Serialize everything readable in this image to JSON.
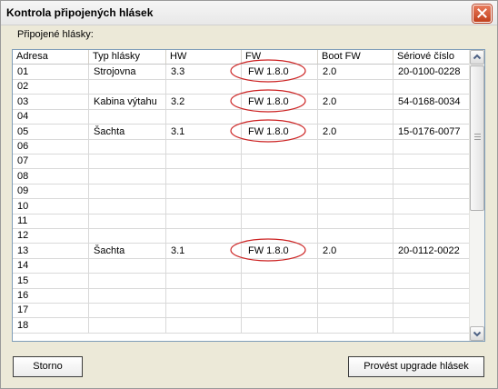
{
  "window": {
    "title": "Kontrola připojených hlásek"
  },
  "group_label": "Připojené hlásky:",
  "table": {
    "columns": [
      "Adresa",
      "Typ hlásky",
      "HW",
      "FW",
      "Boot FW",
      "Sériové číslo"
    ],
    "rows": [
      {
        "adresa": "01",
        "typ": "Strojovna",
        "hw": "3.3",
        "fw": "FW 1.8.0",
        "boot": "2.0",
        "serial": "20-0100-0228",
        "highlighted": true
      },
      {
        "adresa": "02",
        "typ": "",
        "hw": "",
        "fw": "",
        "boot": "",
        "serial": "",
        "highlighted": false
      },
      {
        "adresa": "03",
        "typ": "Kabina výtahu",
        "hw": "3.2",
        "fw": "FW 1.8.0",
        "boot": "2.0",
        "serial": "54-0168-0034",
        "highlighted": true
      },
      {
        "adresa": "04",
        "typ": "",
        "hw": "",
        "fw": "",
        "boot": "",
        "serial": "",
        "highlighted": false
      },
      {
        "adresa": "05",
        "typ": "Šachta",
        "hw": "3.1",
        "fw": "FW 1.8.0",
        "boot": "2.0",
        "serial": "15-0176-0077",
        "highlighted": true
      },
      {
        "adresa": "06",
        "typ": "",
        "hw": "",
        "fw": "",
        "boot": "",
        "serial": "",
        "highlighted": false
      },
      {
        "adresa": "07",
        "typ": "",
        "hw": "",
        "fw": "",
        "boot": "",
        "serial": "",
        "highlighted": false
      },
      {
        "adresa": "08",
        "typ": "",
        "hw": "",
        "fw": "",
        "boot": "",
        "serial": "",
        "highlighted": false
      },
      {
        "adresa": "09",
        "typ": "",
        "hw": "",
        "fw": "",
        "boot": "",
        "serial": "",
        "highlighted": false
      },
      {
        "adresa": "10",
        "typ": "",
        "hw": "",
        "fw": "",
        "boot": "",
        "serial": "",
        "highlighted": false
      },
      {
        "adresa": "11",
        "typ": "",
        "hw": "",
        "fw": "",
        "boot": "",
        "serial": "",
        "highlighted": false
      },
      {
        "adresa": "12",
        "typ": "",
        "hw": "",
        "fw": "",
        "boot": "",
        "serial": "",
        "highlighted": false
      },
      {
        "adresa": "13",
        "typ": "Šachta",
        "hw": "3.1",
        "fw": "FW 1.8.0",
        "boot": "2.0",
        "serial": "20-0112-0022",
        "highlighted": true
      },
      {
        "adresa": "14",
        "typ": "",
        "hw": "",
        "fw": "",
        "boot": "",
        "serial": "",
        "highlighted": false
      },
      {
        "adresa": "15",
        "typ": "",
        "hw": "",
        "fw": "",
        "boot": "",
        "serial": "",
        "highlighted": false
      },
      {
        "adresa": "16",
        "typ": "",
        "hw": "",
        "fw": "",
        "boot": "",
        "serial": "",
        "highlighted": false
      },
      {
        "adresa": "17",
        "typ": "",
        "hw": "",
        "fw": "",
        "boot": "",
        "serial": "",
        "highlighted": false
      },
      {
        "adresa": "18",
        "typ": "",
        "hw": "",
        "fw": "",
        "boot": "",
        "serial": "",
        "highlighted": false
      }
    ]
  },
  "buttons": {
    "cancel": "Storno",
    "upgrade": "Provést upgrade hlásek"
  },
  "colors": {
    "highlight_ellipse": "#cc2222",
    "grid_border": "#7f9db9",
    "close_button": "#c2401c"
  },
  "icons": {
    "close": "close-icon",
    "scroll_up": "chevron-up-icon",
    "scroll_down": "chevron-down-icon"
  }
}
